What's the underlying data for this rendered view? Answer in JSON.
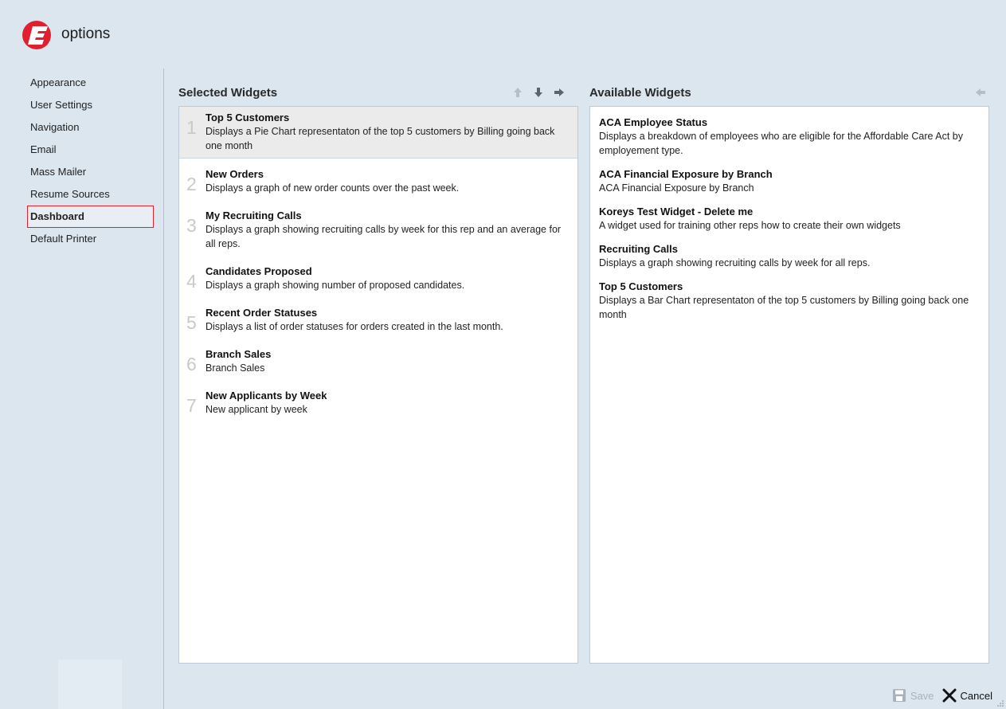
{
  "app": {
    "title": "options"
  },
  "sidebar": {
    "items": [
      {
        "label": "Appearance",
        "active": false
      },
      {
        "label": "User Settings",
        "active": false
      },
      {
        "label": "Navigation",
        "active": false
      },
      {
        "label": "Email",
        "active": false
      },
      {
        "label": "Mass Mailer",
        "active": false
      },
      {
        "label": "Resume Sources",
        "active": false
      },
      {
        "label": "Dashboard",
        "active": true
      },
      {
        "label": "Default Printer",
        "active": false
      }
    ]
  },
  "selected_widgets": {
    "title": "Selected Widgets",
    "items": [
      {
        "num": "1",
        "name": "Top 5 Customers",
        "desc": "Displays a Pie Chart representaton of the top 5 customers by Billing going back one month",
        "selected": true
      },
      {
        "num": "2",
        "name": "New Orders",
        "desc": "Displays a graph of new order counts over the past week.",
        "selected": false
      },
      {
        "num": "3",
        "name": "My Recruiting Calls",
        "desc": "Displays a graph showing recruiting calls by week for this rep and an average for all reps.",
        "selected": false
      },
      {
        "num": "4",
        "name": "Candidates Proposed",
        "desc": "Displays a graph showing number of proposed candidates.",
        "selected": false
      },
      {
        "num": "5",
        "name": "Recent Order Statuses",
        "desc": "Displays a list of order statuses for orders created in the last month.",
        "selected": false
      },
      {
        "num": "6",
        "name": "Branch Sales",
        "desc": "Branch Sales",
        "selected": false
      },
      {
        "num": "7",
        "name": "New Applicants by Week",
        "desc": "New applicant by week",
        "selected": false
      }
    ]
  },
  "available_widgets": {
    "title": "Available Widgets",
    "items": [
      {
        "name": "ACA Employee Status",
        "desc": "Displays a breakdown of employees who are eligible for the Affordable Care Act by employement type."
      },
      {
        "name": "ACA Financial Exposure by Branch",
        "desc": "ACA Financial Exposure by Branch"
      },
      {
        "name": "Koreys Test Widget - Delete me",
        "desc": "A widget used for training other reps how to create their own widgets"
      },
      {
        "name": "Recruiting Calls",
        "desc": "Displays a graph showing recruiting calls by week for all reps."
      },
      {
        "name": "Top 5 Customers",
        "desc": "Displays a Bar Chart representaton of the top 5 customers by Billing going back one month"
      }
    ]
  },
  "toolbar": {
    "move_up": "arrow-up-icon",
    "move_down": "arrow-down-icon",
    "move_right": "arrow-right-icon",
    "move_left": "arrow-left-icon"
  },
  "footer": {
    "save_label": "Save",
    "cancel_label": "Cancel"
  },
  "colors": {
    "background": "#dbe6ef",
    "brand_red": "#e0202f",
    "active_border": "#e0202f",
    "disabled": "#a8b2bc"
  }
}
